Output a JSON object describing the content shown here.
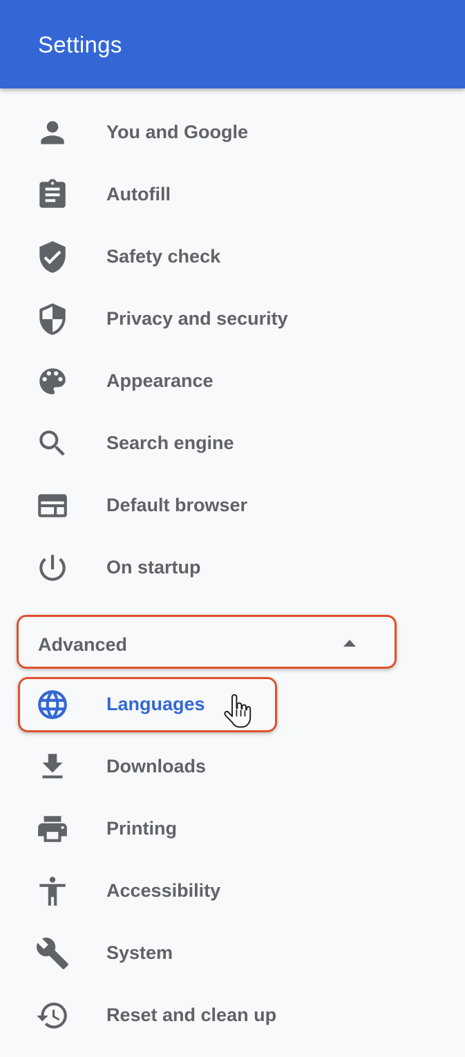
{
  "header": {
    "title": "Settings"
  },
  "menu": [
    {
      "label": "You and Google",
      "icon": "person-icon"
    },
    {
      "label": "Autofill",
      "icon": "clipboard-icon"
    },
    {
      "label": "Safety check",
      "icon": "shield-check-icon"
    },
    {
      "label": "Privacy and security",
      "icon": "shield-icon"
    },
    {
      "label": "Appearance",
      "icon": "palette-icon"
    },
    {
      "label": "Search engine",
      "icon": "search-icon"
    },
    {
      "label": "Default browser",
      "icon": "browser-window-icon"
    },
    {
      "label": "On startup",
      "icon": "power-icon"
    }
  ],
  "advanced": {
    "label": "Advanced",
    "expanded": true,
    "icon": "caret-up-icon"
  },
  "advanced_menu": [
    {
      "label": "Languages",
      "icon": "globe-icon",
      "selected": true
    },
    {
      "label": "Downloads",
      "icon": "download-icon"
    },
    {
      "label": "Printing",
      "icon": "printer-icon"
    },
    {
      "label": "Accessibility",
      "icon": "accessibility-icon"
    },
    {
      "label": "System",
      "icon": "wrench-icon"
    },
    {
      "label": "Reset and clean up",
      "icon": "restore-icon"
    }
  ],
  "colors": {
    "header": "#3367d6",
    "accent": "#3367d6",
    "text": "#5f6368",
    "highlight_border": "#e0512b",
    "background": "#f8f9fa"
  }
}
